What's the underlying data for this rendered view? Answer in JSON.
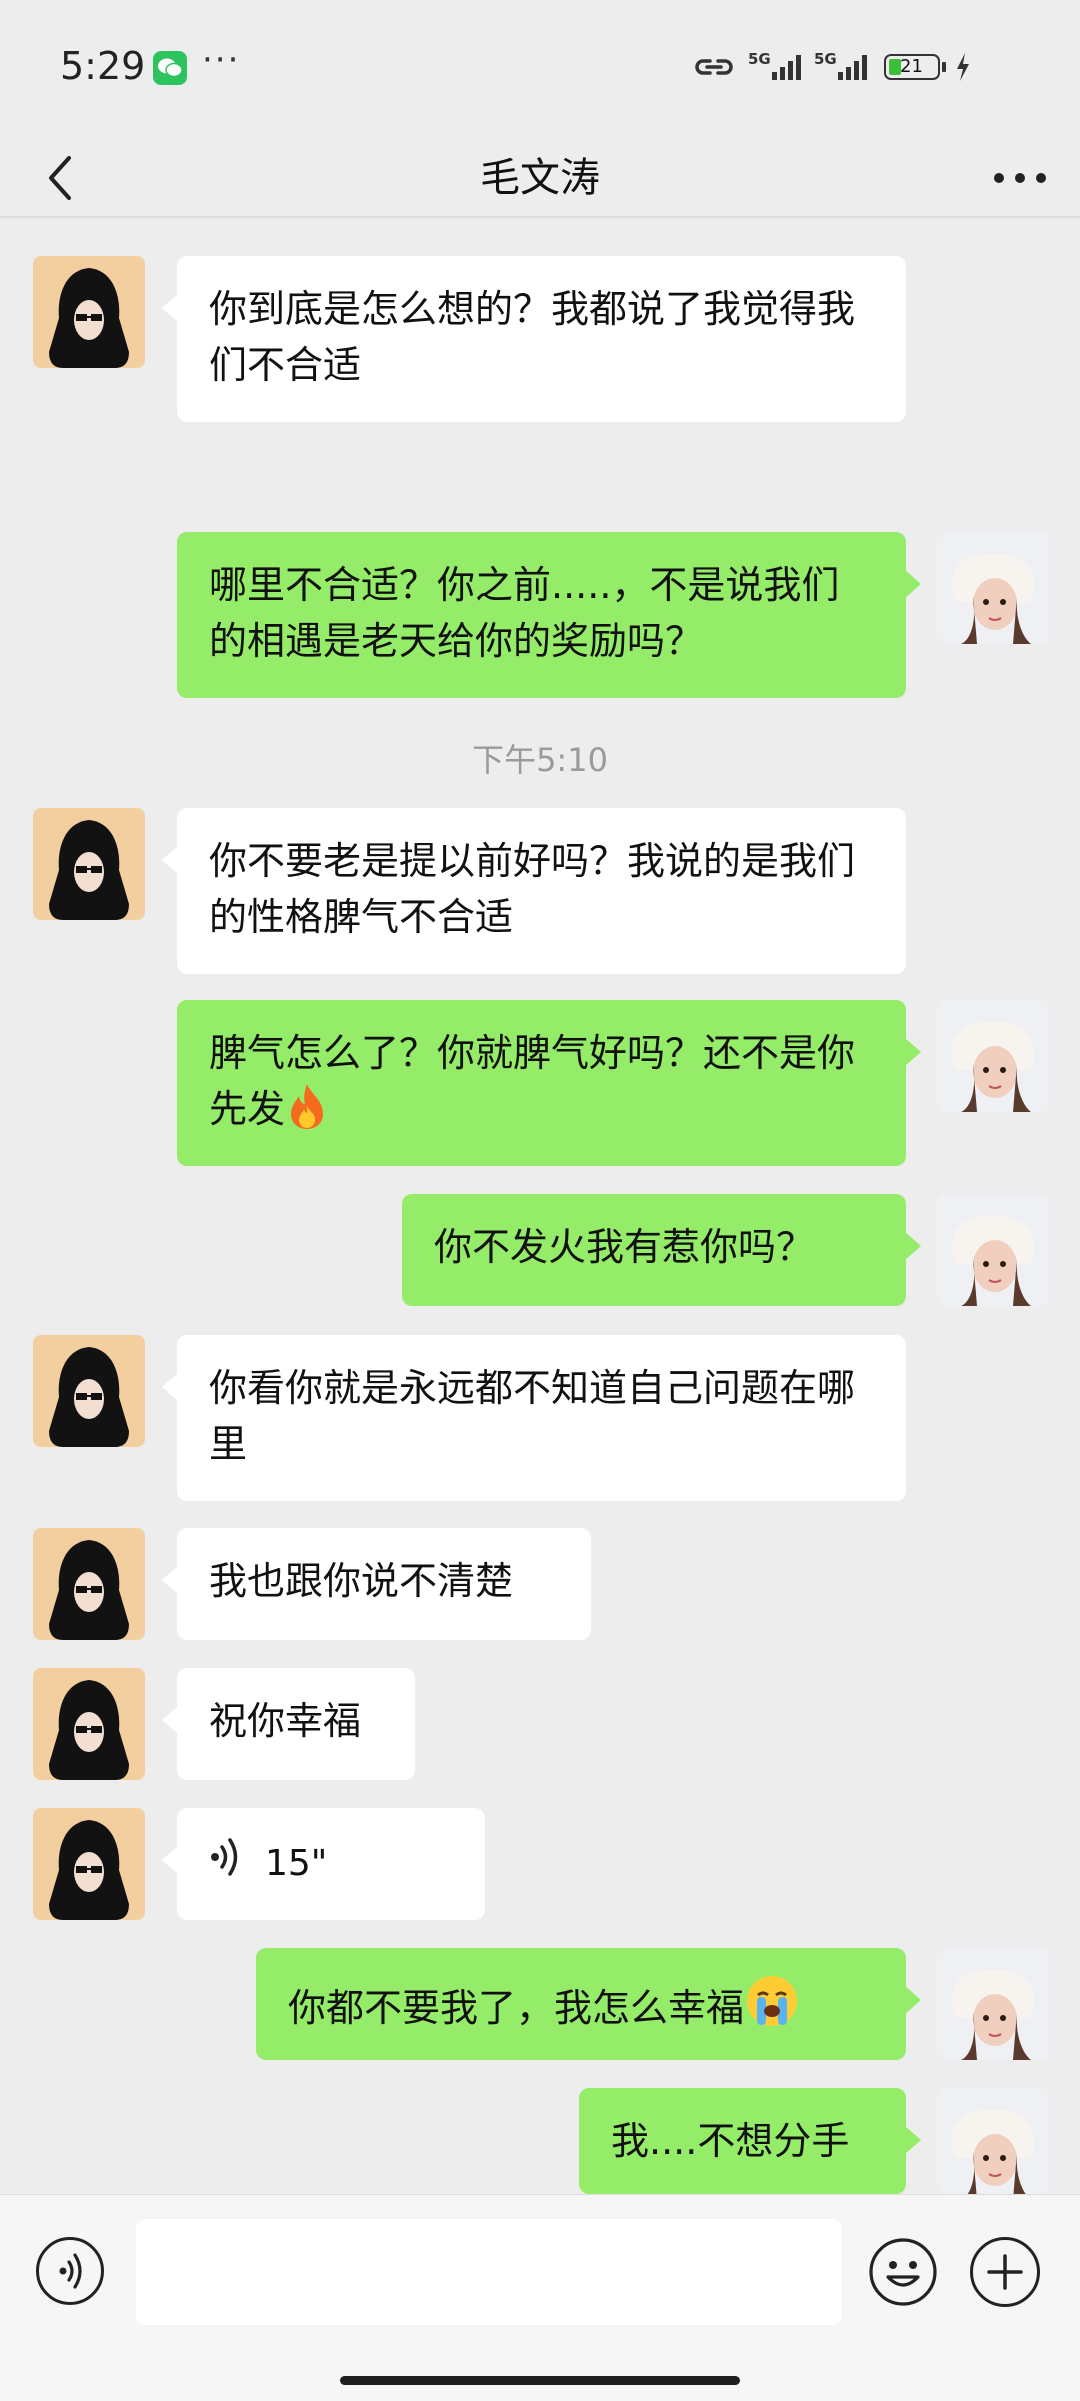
{
  "status_bar": {
    "time": "5:29",
    "more": "···",
    "signal1_label": "5G",
    "signal2_label": "5G",
    "battery": "21"
  },
  "header": {
    "title": "毛文涛",
    "back_icon": "chevron-left-icon",
    "more_icon": "more-horizontal-icon"
  },
  "messages": [
    {
      "side": "in",
      "text": "你到底是怎么想的？我都说了我觉得我们不合适"
    },
    {
      "side": "out",
      "text": "哪里不合适？你之前.....，不是说我们的相遇是老天给你的奖励吗？"
    },
    {
      "timestamp": "下午5:10"
    },
    {
      "side": "in",
      "text": "你不要老是提以前好吗？我说的是我们的性格脾气不合适"
    },
    {
      "side": "out",
      "text": "脾气怎么了？你就脾气好吗？还不是你先发",
      "emoji": "fire-emoji"
    },
    {
      "side": "out",
      "text": "你不发火我有惹你吗？"
    },
    {
      "side": "in",
      "text": "你看你就是永远都不知道自己问题在哪里"
    },
    {
      "side": "in",
      "text": "我也跟你说不清楚"
    },
    {
      "side": "in",
      "text": "祝你幸福"
    },
    {
      "side": "in",
      "type": "voice",
      "duration": "15\""
    },
    {
      "side": "out",
      "text": "你都不要我了，我怎么幸福",
      "emoji": "loudly-crying-emoji"
    },
    {
      "side": "out",
      "text": "我....不想分手"
    }
  ],
  "input_bar": {
    "voice_icon": "voice-input-icon",
    "emoji_icon": "emoji-icon",
    "plus_icon": "plus-icon",
    "value": ""
  },
  "colors": {
    "background": "#ededed",
    "outgoing_bubble": "#95ec69",
    "incoming_bubble": "#ffffff",
    "timestamp": "#9a9a9a"
  }
}
